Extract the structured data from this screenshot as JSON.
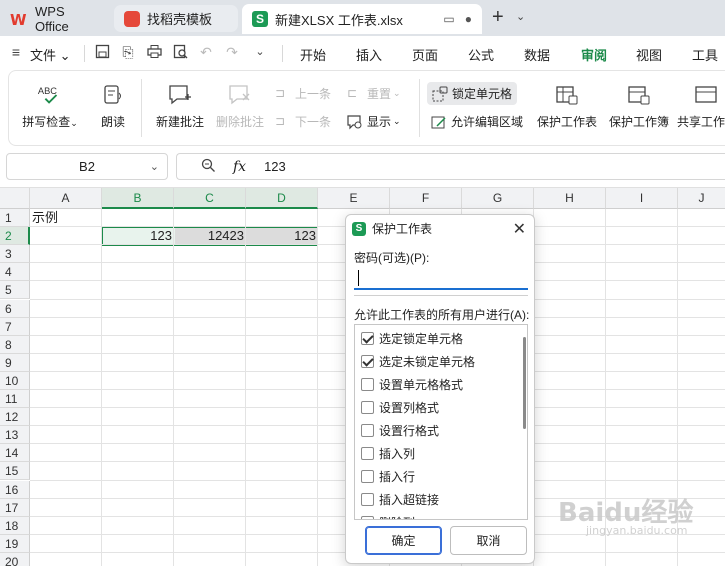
{
  "tabs": {
    "wps_label": "WPS Office",
    "daoke_label": "找稻壳模板",
    "file_label": "新建XLSX 工作表.xlsx",
    "new_tab": "+",
    "tab_list": "⌄"
  },
  "menu": {
    "file_label": "文件",
    "tabs": [
      "开始",
      "插入",
      "页面",
      "公式",
      "数据",
      "审阅",
      "视图",
      "工具"
    ],
    "active_tab": "审阅"
  },
  "ribbon": {
    "spellcheck": "拼写检查",
    "read_aloud": "朗读",
    "new_comment": "新建批注",
    "delete_comment": "删除批注",
    "prev": "上一条",
    "next": "下一条",
    "reset": "重置",
    "show": "显示",
    "lock_cell": "锁定单元格",
    "allow_edit": "允许编辑区域",
    "protect_sheet": "保护工作表",
    "protect_book": "保护工作簿",
    "share_book": "共享工作",
    "abc": "ABC"
  },
  "formula": {
    "name_box": "B2",
    "fx_label": "fx",
    "value": "123"
  },
  "grid": {
    "columns": [
      "A",
      "B",
      "C",
      "D",
      "E",
      "F",
      "G",
      "H",
      "I",
      "J"
    ],
    "rows": [
      "1",
      "2",
      "3",
      "4",
      "5",
      "6",
      "7",
      "8",
      "9",
      "10",
      "11",
      "12",
      "13",
      "14",
      "15",
      "16",
      "17",
      "18",
      "19",
      "20"
    ],
    "a1": "示例",
    "b2": "123",
    "c2": "12423",
    "d2": "123"
  },
  "dialog": {
    "title": "保护工作表",
    "password_label": "密码(可选)(P):",
    "allow_label": "允许此工作表的所有用户进行(A):",
    "permissions": [
      {
        "label": "选定锁定单元格",
        "checked": true
      },
      {
        "label": "选定未锁定单元格",
        "checked": true
      },
      {
        "label": "设置单元格格式",
        "checked": false
      },
      {
        "label": "设置列格式",
        "checked": false
      },
      {
        "label": "设置行格式",
        "checked": false
      },
      {
        "label": "插入列",
        "checked": false
      },
      {
        "label": "插入行",
        "checked": false
      },
      {
        "label": "插入超链接",
        "checked": false
      },
      {
        "label": "删除列",
        "checked": false
      }
    ],
    "ok": "确定",
    "cancel": "取消",
    "close": "✕"
  },
  "watermark": {
    "main": "Baidu经验",
    "sub": "jingyan.baidu.com"
  },
  "colors": {
    "accent_green": "#1c8a4a",
    "sheet_icon": "#1c9a55",
    "wps_red": "#e23b2e",
    "focus_blue": "#1a6fd1"
  }
}
